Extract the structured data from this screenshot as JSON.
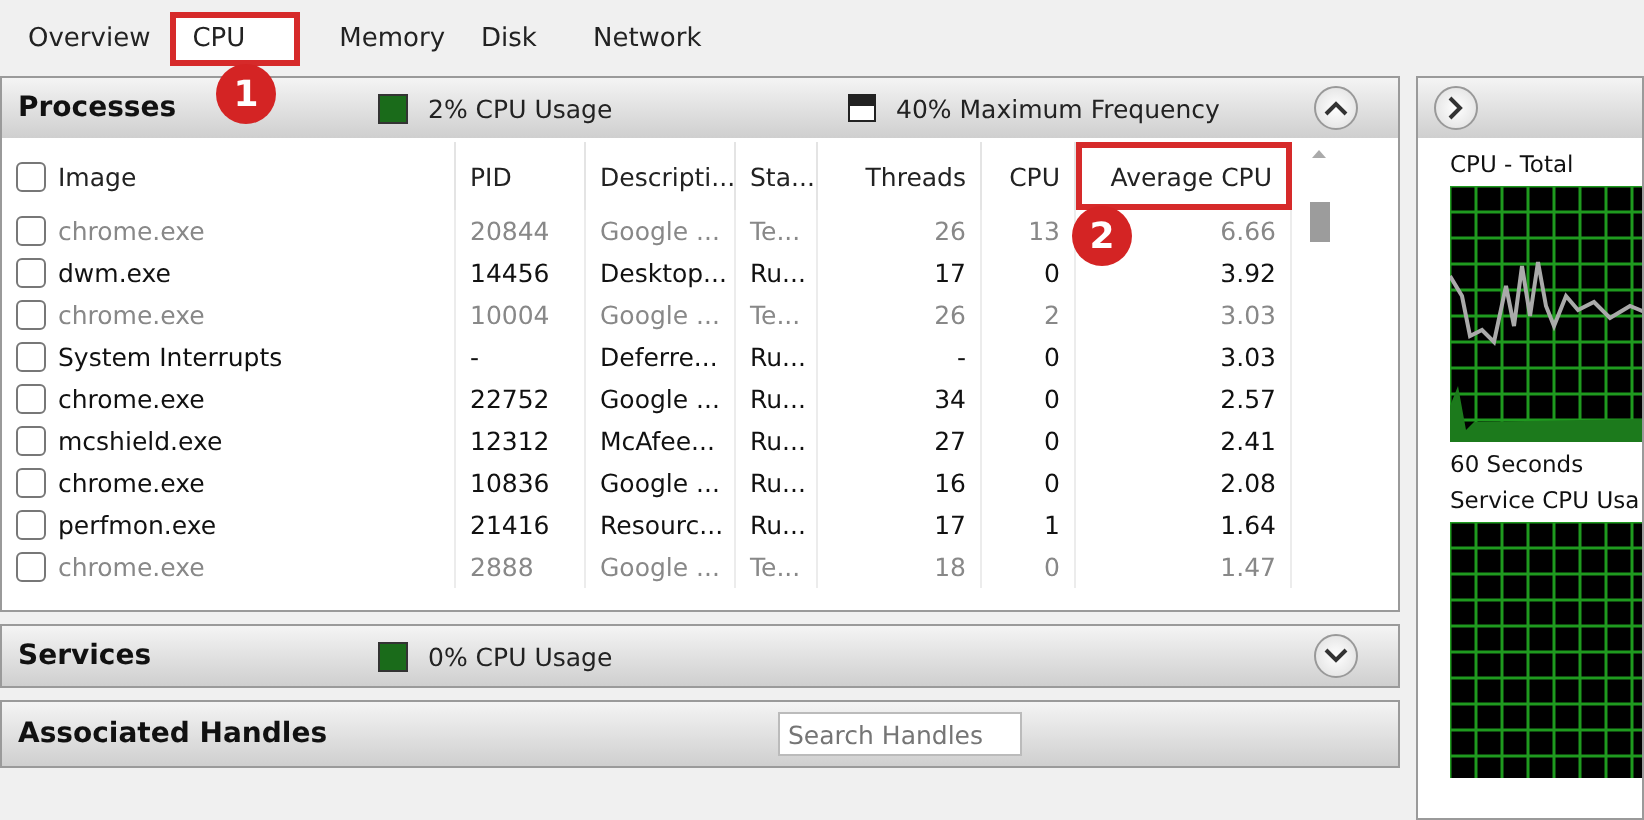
{
  "tabs": [
    {
      "label": "Overview",
      "selected": false
    },
    {
      "label": "CPU",
      "selected": true
    },
    {
      "label": "Memory",
      "selected": false
    },
    {
      "label": "Disk",
      "selected": false
    },
    {
      "label": "Network",
      "selected": false
    }
  ],
  "processes": {
    "title": "Processes",
    "usage": "2% CPU Usage",
    "frequency": "40% Maximum Frequency",
    "expanded": true,
    "select_all_checked": false,
    "columns": [
      "Image",
      "PID",
      "Descripti...",
      "Sta...",
      "Threads",
      "CPU",
      "Average CPU"
    ],
    "rows": [
      {
        "image": "chrome.exe",
        "pid": "20844",
        "description": "Google ...",
        "status": "Te...",
        "threads": "26",
        "cpu": "13",
        "average_cpu": "6.66",
        "terminated": true,
        "checked": false
      },
      {
        "image": "dwm.exe",
        "pid": "14456",
        "description": "Desktop...",
        "status": "Ru...",
        "threads": "17",
        "cpu": "0",
        "average_cpu": "3.92",
        "terminated": false,
        "checked": false
      },
      {
        "image": "chrome.exe",
        "pid": "10004",
        "description": "Google ...",
        "status": "Te...",
        "threads": "26",
        "cpu": "2",
        "average_cpu": "3.03",
        "terminated": true,
        "checked": false
      },
      {
        "image": "System Interrupts",
        "pid": "-",
        "description": "Deferre...",
        "status": "Ru...",
        "threads": "-",
        "cpu": "0",
        "average_cpu": "3.03",
        "terminated": false,
        "checked": false
      },
      {
        "image": "chrome.exe",
        "pid": "22752",
        "description": "Google ...",
        "status": "Ru...",
        "threads": "34",
        "cpu": "0",
        "average_cpu": "2.57",
        "terminated": false,
        "checked": false
      },
      {
        "image": "mcshield.exe",
        "pid": "12312",
        "description": "McAfee...",
        "status": "Ru...",
        "threads": "27",
        "cpu": "0",
        "average_cpu": "2.41",
        "terminated": false,
        "checked": false
      },
      {
        "image": "chrome.exe",
        "pid": "10836",
        "description": "Google ...",
        "status": "Ru...",
        "threads": "16",
        "cpu": "0",
        "average_cpu": "2.08",
        "terminated": false,
        "checked": false
      },
      {
        "image": "perfmon.exe",
        "pid": "21416",
        "description": "Resourc...",
        "status": "Ru...",
        "threads": "17",
        "cpu": "1",
        "average_cpu": "1.64",
        "terminated": false,
        "checked": false
      },
      {
        "image": "chrome.exe",
        "pid": "2888",
        "description": "Google ...",
        "status": "Te...",
        "threads": "18",
        "cpu": "0",
        "average_cpu": "1.47",
        "terminated": true,
        "checked": false
      }
    ]
  },
  "services": {
    "title": "Services",
    "usage": "0% CPU Usage",
    "expanded": false
  },
  "associated_handles": {
    "title": "Associated Handles",
    "search": {
      "placeholder": "Search Handles"
    }
  },
  "side_panel": {
    "graphs": [
      {
        "title": "CPU - Total",
        "caption": "60 Seconds"
      },
      {
        "title": "Service CPU Usa"
      }
    ]
  },
  "annotations": [
    {
      "label": "1"
    },
    {
      "label": "2"
    }
  ]
}
